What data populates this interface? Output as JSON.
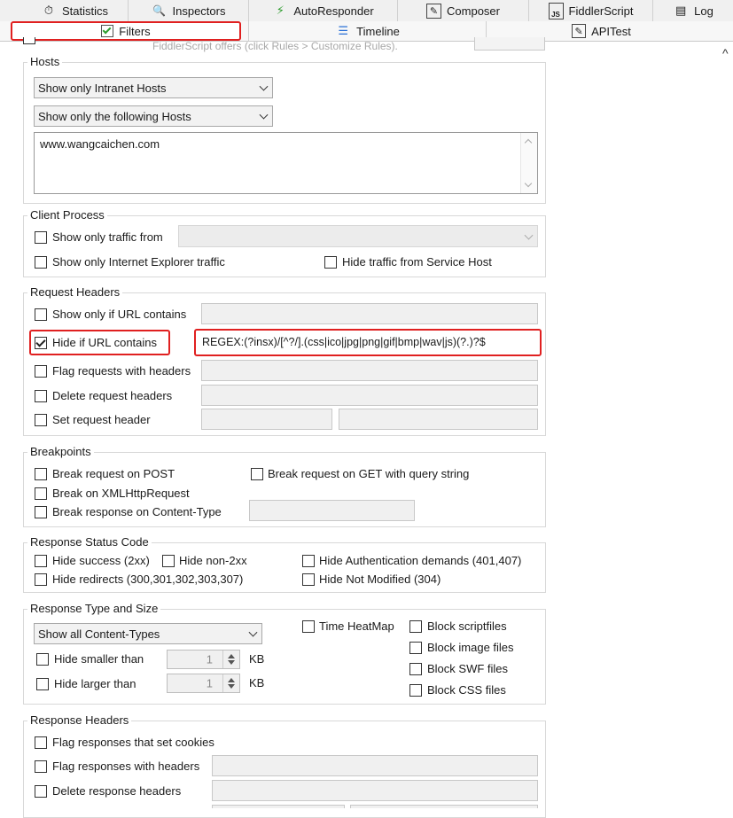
{
  "tabs_row1": [
    {
      "label": "Statistics",
      "icon": "stopwatch-icon",
      "glyph": "⏱"
    },
    {
      "label": "Inspectors",
      "icon": "inspector-icon",
      "glyph": "🔍"
    },
    {
      "label": "AutoResponder",
      "icon": "lightning-icon",
      "glyph": "⚡"
    },
    {
      "label": "Composer",
      "icon": "composer-icon",
      "glyph": "✎"
    },
    {
      "label": "FiddlerScript",
      "icon": "script-icon",
      "glyph": "JS"
    },
    {
      "label": "Log",
      "icon": "log-icon",
      "glyph": "▤"
    }
  ],
  "tabs_row2": [
    {
      "label": "Filters",
      "icon": "checkbox-icon"
    },
    {
      "label": "Timeline",
      "icon": "timeline-icon",
      "glyph": "☰"
    },
    {
      "label": "APITest",
      "icon": "api-icon",
      "glyph": "✎"
    }
  ],
  "top_note": "FiddlerScript offers (click Rules > Customize Rules).",
  "hosts": {
    "legend": "Hosts",
    "intranet_select": "Show only Intranet Hosts",
    "hosts_select": "Show only the following Hosts",
    "hosts_text": "www.wangcaichen.com"
  },
  "client_process": {
    "legend": "Client Process",
    "show_traffic_from": "Show only traffic from",
    "show_ie": "Show only Internet Explorer traffic",
    "hide_service_host": "Hide traffic from Service Host"
  },
  "request_headers": {
    "legend": "Request Headers",
    "show_if_url": "Show only if URL contains",
    "hide_if_url": "Hide if URL contains",
    "hide_if_url_value": "REGEX:(?insx)/[^?/].(css|ico|jpg|png|gif|bmp|wav|js)(?.)?$",
    "flag_requests": "Flag requests with headers",
    "delete_request": "Delete request headers",
    "set_request": "Set request header"
  },
  "breakpoints": {
    "legend": "Breakpoints",
    "break_post": "Break request on POST",
    "break_get": "Break request on GET with query string",
    "break_xhr": "Break on XMLHttpRequest",
    "break_response": "Break response on Content-Type"
  },
  "status_code": {
    "legend": "Response Status Code",
    "hide_success": "Hide success (2xx)",
    "hide_non2xx": "Hide non-2xx",
    "hide_auth": "Hide Authentication demands (401,407)",
    "hide_redirects": "Hide redirects (300,301,302,303,307)",
    "hide_not_modified": "Hide Not Modified (304)"
  },
  "type_size": {
    "legend": "Response Type and Size",
    "content_select": "Show all Content-Types",
    "time_heatmap": "Time HeatMap",
    "block_script": "Block scriptfiles",
    "block_image": "Block image files",
    "block_swf": "Block SWF files",
    "block_css": "Block CSS files",
    "hide_smaller": "Hide smaller than",
    "hide_larger": "Hide larger than",
    "smaller_value": "1",
    "larger_value": "1",
    "unit": "KB"
  },
  "response_headers": {
    "legend": "Response Headers",
    "flag_cookies": "Flag responses that set cookies",
    "flag_headers": "Flag responses with headers",
    "delete_headers": "Delete response headers"
  },
  "scroll_arrow": "^"
}
